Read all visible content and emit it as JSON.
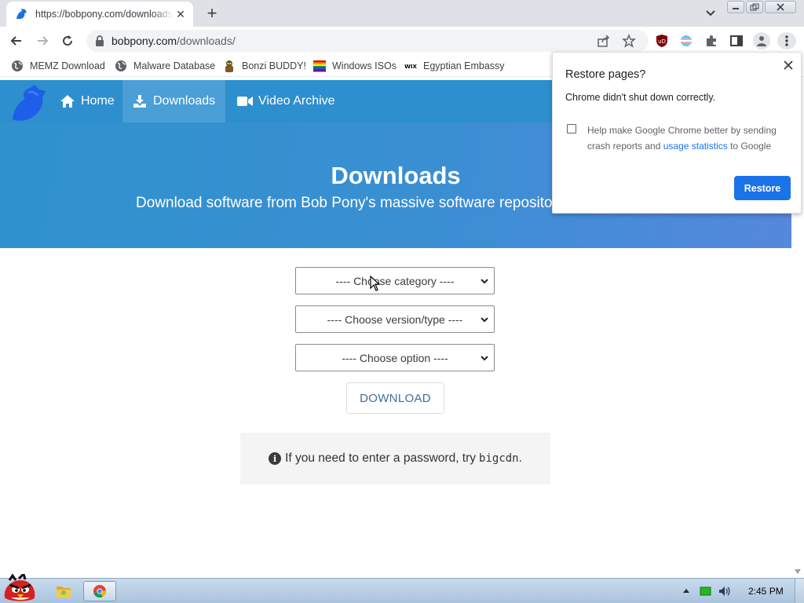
{
  "browser": {
    "tab": {
      "title": "https://bobpony.com/downloads/",
      "close_label": "✕"
    },
    "newtab_label": "+",
    "url_host": "bobpony.com",
    "url_path": "/downloads/",
    "icons": [
      "back-icon",
      "forward-icon",
      "reload-icon",
      "lock-icon",
      "share-icon",
      "star-icon",
      "ublock-icon",
      "flag-extension-icon",
      "extensions-icon",
      "side-panel-icon",
      "profile-icon",
      "menu-icon"
    ]
  },
  "bookmarks": [
    {
      "label": "MEMZ Download",
      "icon": "globe-icon"
    },
    {
      "label": "Malware Database",
      "icon": "globe-icon"
    },
    {
      "label": "Bonzi BUDDY!",
      "icon": "bonzi-icon"
    },
    {
      "label": "Windows ISOs",
      "icon": "windows-flag-icon"
    },
    {
      "label": "Egyptian Embassy",
      "icon": "wix-icon"
    }
  ],
  "site": {
    "nav": [
      {
        "label": "Home",
        "icon": "home-icon"
      },
      {
        "label": "Downloads",
        "icon": "download-icon",
        "active": true
      },
      {
        "label": "Video Archive",
        "icon": "video-icon"
      }
    ],
    "hero_title": "Downloads",
    "hero_subtitle": "Download software from Bob Pony's massive software repository.",
    "selects": {
      "category": "---- Choose category ----",
      "version": "---- Choose version/type ----",
      "option": "---- Choose option ----"
    },
    "download_button": "DOWNLOAD",
    "notice_text": "If you need to enter a password, try",
    "notice_code": "bigcdn",
    "notice_end": "."
  },
  "popup": {
    "title": "Restore pages?",
    "message": "Chrome didn't shut down correctly.",
    "checkbox_text_1": "Help make Google Chrome better by sending crash reports and ",
    "checkbox_link": "usage statistics",
    "checkbox_text_2": " to Google",
    "button": "Restore"
  },
  "taskbar": {
    "clock": "2:45 PM",
    "items": [
      "explorer-icon",
      "chrome-icon"
    ]
  },
  "colors": {
    "site_primary": "#2d8fcd",
    "chrome_blue": "#1a73e8",
    "tab_strip": "#dee1e6"
  }
}
